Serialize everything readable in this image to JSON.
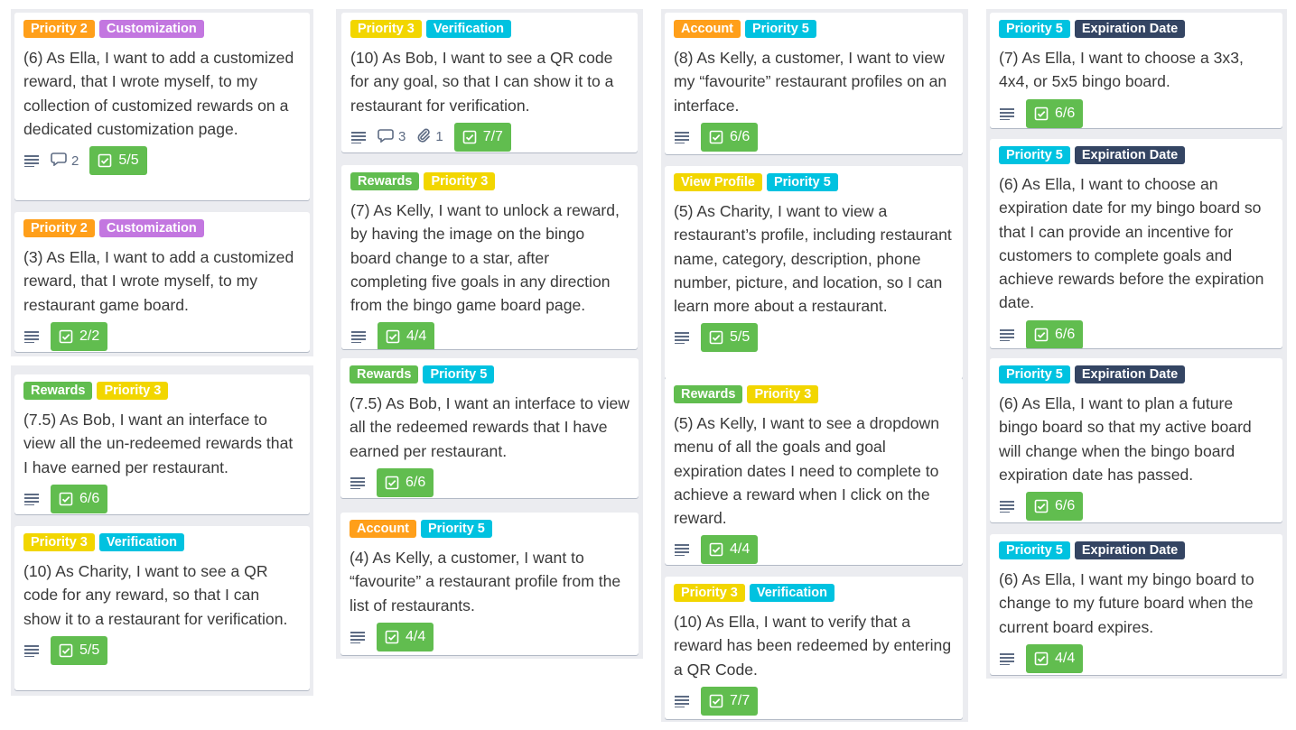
{
  "colors": {
    "orange": "#ff9f1a",
    "purple": "#c377e0",
    "yellow": "#f2d600",
    "sky": "#00c2e0",
    "green": "#61bd4f",
    "navy": "#344563",
    "list_bg": "#ebecf0",
    "card_bg": "#ffffff"
  },
  "icons": {
    "description": "description-lines-icon",
    "comment": "comment-icon",
    "attachment": "paperclip-icon",
    "checklist": "checklist-icon"
  },
  "cards": [
    {
      "labels": [
        "Priority 2",
        "Customization"
      ],
      "title": "(6) As Ella, I want to add a customized reward, that I wrote myself, to my collection of customized rewards on a dedicated customization page.",
      "comments": "2",
      "checklist": "5/5"
    },
    {
      "labels": [
        "Priority 2",
        "Customization"
      ],
      "title": "(3) As Ella, I want to add a customized reward, that I wrote myself, to my restaurant game board.",
      "checklist": "2/2"
    },
    {
      "labels": [
        "Rewards",
        "Priority 3"
      ],
      "title": "(7.5) As Bob, I want an interface to view all the un-redeemed rewards that I have earned per restaurant.",
      "checklist": "6/6"
    },
    {
      "labels": [
        "Priority 3",
        "Verification"
      ],
      "title": "(10) As Charity, I want to see a QR code for any reward, so that I can show it to a restaurant for verification.",
      "checklist": "5/5"
    },
    {
      "labels": [
        "Priority 3",
        "Verification"
      ],
      "title": "(10) As Bob, I want to see a QR code for any goal, so that I can show it to a restaurant for verification.",
      "comments": "3",
      "attachments": "1",
      "checklist": "7/7"
    },
    {
      "labels": [
        "Rewards",
        "Priority 3"
      ],
      "title": "(7) As Kelly, I want to unlock a reward, by having the image on the bingo board change to a star, after completing five goals in any direction from the bingo game board page.",
      "checklist": "4/4"
    },
    {
      "labels": [
        "Rewards",
        "Priority 5"
      ],
      "title": "(7.5) As Bob, I want an interface to view all the redeemed rewards that I have earned per restaurant.",
      "checklist": "6/6"
    },
    {
      "labels": [
        "Account",
        "Priority 5"
      ],
      "title": "(4) As Kelly, a customer, I want to “favourite” a restaurant profile from the list of restaurants.",
      "checklist": "4/4"
    },
    {
      "labels": [
        "Account",
        "Priority 5"
      ],
      "title": "(8) As Kelly, a customer, I want to view my “favourite” restaurant profiles on an interface.",
      "checklist": "6/6"
    },
    {
      "labels": [
        "View Profile",
        "Priority 5"
      ],
      "title": "(5) As Charity, I want to view a restaurant’s profile, including restaurant name, category, description, phone number, picture, and location, so I can learn more about a restaurant.",
      "checklist": "5/5"
    },
    {
      "labels": [
        "Rewards",
        "Priority 3"
      ],
      "title": "(5) As Kelly, I want to see a dropdown menu of all the goals and goal expiration dates I need to complete to achieve a reward when I click on the reward.",
      "checklist": "4/4"
    },
    {
      "labels": [
        "Priority 3",
        "Verification"
      ],
      "title": "(10) As Ella, I want to verify that a reward has been redeemed by entering a QR Code.",
      "checklist": "7/7"
    },
    {
      "labels": [
        "Priority 5",
        "Expiration Date"
      ],
      "title": "(7) As Ella, I want to choose a 3x3, 4x4, or 5x5 bingo board.",
      "checklist": "6/6"
    },
    {
      "labels": [
        "Priority 5",
        "Expiration Date"
      ],
      "title": "(6) As Ella, I want to choose an expiration date for my bingo board so that I can provide an incentive for customers to complete goals and achieve rewards before the expiration date.",
      "checklist": "6/6"
    },
    {
      "labels": [
        "Priority 5",
        "Expiration Date"
      ],
      "title": "(6) As Ella, I want to plan a future bingo board so that my active board will change when the bingo board expiration date has passed.",
      "checklist": "6/6"
    },
    {
      "labels": [
        "Priority 5",
        "Expiration Date"
      ],
      "title": "(6) As Ella, I want my bingo board to change to my future board when the current board expires.",
      "checklist": "4/4"
    }
  ]
}
